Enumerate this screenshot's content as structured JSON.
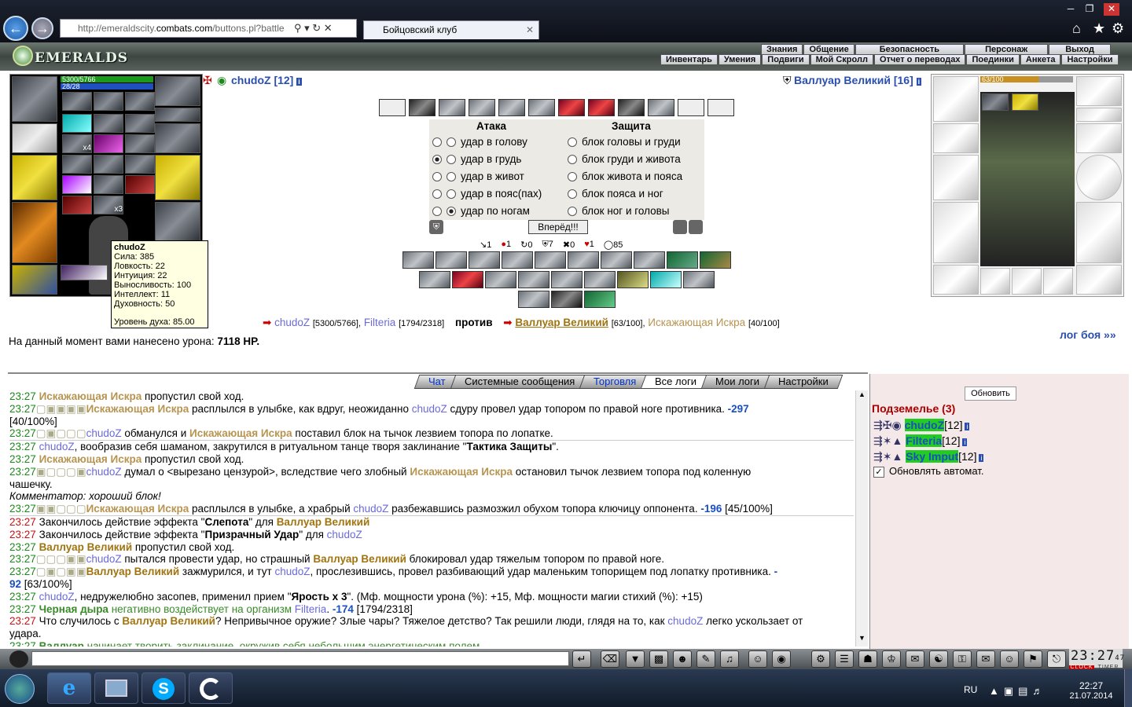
{
  "browser": {
    "url_prefix": "http://emeraldscity.",
    "url_domain": "combats.com",
    "url_suffix": "/buttons.pl?battle",
    "tab_title": "Бойцовский клуб"
  },
  "game": {
    "logo": "EMERALDS",
    "menu_top": [
      "Знания",
      "Общение",
      "Безопасность",
      "Персонаж",
      "Выход"
    ],
    "menu_bottom": [
      "Инвентарь",
      "Умения",
      "Подвиги",
      "Мой Скролл",
      "Отчет о переводах",
      "Поединки",
      "Анкета",
      "Настройки"
    ]
  },
  "player": {
    "name": "chudoZ",
    "level": "[12]",
    "hp": "5300/5766",
    "mana": "28/28",
    "stack1": "x4",
    "stack2": "x3",
    "tooltip": {
      "name": "chudoZ",
      "lines": [
        "Сила: 385",
        "Ловкость: 22",
        "Интуиция: 22",
        "Выносливость: 100",
        "Интеллект: 11",
        "Духовность: 50"
      ],
      "spirit": "Уровень духа: 85.00"
    }
  },
  "enemy": {
    "name": "Валлуар Великий",
    "level": "[16]",
    "hp": "63/100"
  },
  "attack": {
    "header_attack": "Атака",
    "header_defense": "Защита",
    "attacks": [
      "удар в голову",
      "удар в грудь",
      "удар в живот",
      "удар в пояс(пах)",
      "удар по ногам"
    ],
    "blocks": [
      "блок головы и груди",
      "блок груди и живота",
      "блок живота и пояса",
      "блок пояса и ног",
      "блок ног и головы"
    ],
    "go": "Вперёд!!!",
    "counters": [
      "1",
      "1",
      "0",
      "7",
      "0",
      "1",
      "85"
    ]
  },
  "versus": {
    "p1": "chudoZ",
    "p1hp": "[5300/5766],",
    "p2": "Filteria",
    "p2hp": "[1794/2318]",
    "vs": "против",
    "e1": "Валлуар Великий",
    "e1hp": "[63/100],",
    "e2": "Искажающая Искра",
    "e2hp": "[40/100]"
  },
  "damage": {
    "label": "На данный момент вами нанесено урона:",
    "value": "7118 HP."
  },
  "log_link": "лог боя »»",
  "chat_tabs": [
    "Чат",
    "Системные сообщения",
    "Торговля",
    "Все логи",
    "Мои логи",
    "Настройки"
  ],
  "log": {
    "l1": {
      "t": "23:27",
      "a": "Искажающая Искра",
      "b": " пропустил свой ход."
    },
    "l2": {
      "t": "23:27",
      "a": "Искажающая Искра",
      "b": " расплылся в улыбке, как вдруг, неожиданно ",
      "c": "chudoZ",
      "d": " сдуру провел удар топором по правой ноге противника. ",
      "e": "-297"
    },
    "l2b": "[40/100%]",
    "l3": {
      "t": "23:27",
      "a": "chudoZ",
      "b": " обманулся и ",
      "c": "Искажающая Искра",
      "d": " поставил блок на тычок лезвием топора по лопатке."
    },
    "l4": {
      "t": "23:27",
      "a": "chudoZ",
      "b": ", вообразив себя шаманом, закрутился в ритуальном танце творя заклинание \"",
      "c": "Тактика Защиты",
      "d": "\"."
    },
    "l5": {
      "t": "23:27",
      "a": "Искажающая Искра",
      "b": " пропустил свой ход."
    },
    "l6": {
      "t": "23:27",
      "a": "chudoZ",
      "b": " думал о <вырезано цензурой>, вследствие чего злобный ",
      "c": "Искажающая Искра",
      "d": " остановил тычок лезвием топора под коленную"
    },
    "l6b": "чашечку.",
    "l7": "Комментатор: хороший блок!",
    "l8": {
      "t": "23:27",
      "a": "Искажающая Искра",
      "b": " расплылся в улыбке, а храбрый ",
      "c": "chudoZ",
      "d": " разбежавшись размозжил обухом топора ключицу оппонента. ",
      "e": "-196",
      "f": " [45/100%]"
    },
    "l9": {
      "t": "23:27",
      "a": "Закончилось действие эффекта \"",
      "b": "Слепота",
      "c": "\" для ",
      "d": "Валлуар Великий"
    },
    "l10": {
      "t": "23:27",
      "a": "Закончилось действие эффекта \"",
      "b": "Призрачный Удар",
      "c": "\" для ",
      "d": "chudoZ"
    },
    "l11": {
      "t": "23:27",
      "a": "Валлуар Великий",
      "b": " пропустил свой ход."
    },
    "l12": {
      "t": "23:27",
      "a": "chudoZ",
      "b": " пытался провести удар, но страшный ",
      "c": "Валлуар Великий",
      "d": " блокировал удар тяжелым топором по правой ноге."
    },
    "l13": {
      "t": "23:27",
      "a": "Валлуар Великий",
      "b": " зажмурился, и тут ",
      "c": "chudoZ",
      "d": ", прослезившись, провел разбивающий удар маленьким топорищем под лопатку противника. ",
      "e": "-"
    },
    "l13b": {
      "a": "92",
      "b": " [63/100%]"
    },
    "l14": {
      "t": "23:27",
      "a": "chudoZ",
      "b": ", недружелюбно засопев, применил прием \"",
      "c": "Ярость x 3",
      "d": "\". (Мф. мощности урона (%): +15, Мф. мощности магии стихий (%): +15)"
    },
    "l15": {
      "t": "23:27",
      "a": "Черная дыра",
      "b": " негативно воздействует на организм ",
      "c": "Filteria",
      "d": ". ",
      "e": "-174",
      "f": " [1794/2318]"
    },
    "l16": {
      "t": "23:27",
      "a": "Что случилось с ",
      "b": "Валлуар Великий",
      "c": "? Непривычное оружие? Злые чары? Тяжелое детство? Так решили люди, глядя на то, как ",
      "d": "chudoZ",
      "e": " легко ускользает от"
    },
    "l16b": "удара.",
    "l17": {
      "t": "23:27",
      "a": "Валлуар",
      "b": " начинает творить заклинание, окружив себя небольшим энергетическим полем."
    }
  },
  "side": {
    "refresh": "Обновить",
    "location": "Подземелье (3)",
    "members": [
      {
        "name": "chudoZ",
        "level": "[12]"
      },
      {
        "name": "Filteria",
        "level": "[12]"
      },
      {
        "name": "Sky Imput",
        "level": "[12]"
      }
    ],
    "auto": "Обновлять автомат."
  },
  "clock": {
    "time": "23:27",
    "sec": "47",
    "clock_label": "CLOCK",
    "timer_label": "TIMER"
  },
  "taskbar": {
    "lang": "RU",
    "time": "22:27",
    "date": "21.07.2014"
  },
  "colors": {
    "accent_green": "#1c8a1c",
    "time_red": "#cc1111",
    "player_blue": "#2a4fb0",
    "enemy_gold": "#a07410"
  }
}
